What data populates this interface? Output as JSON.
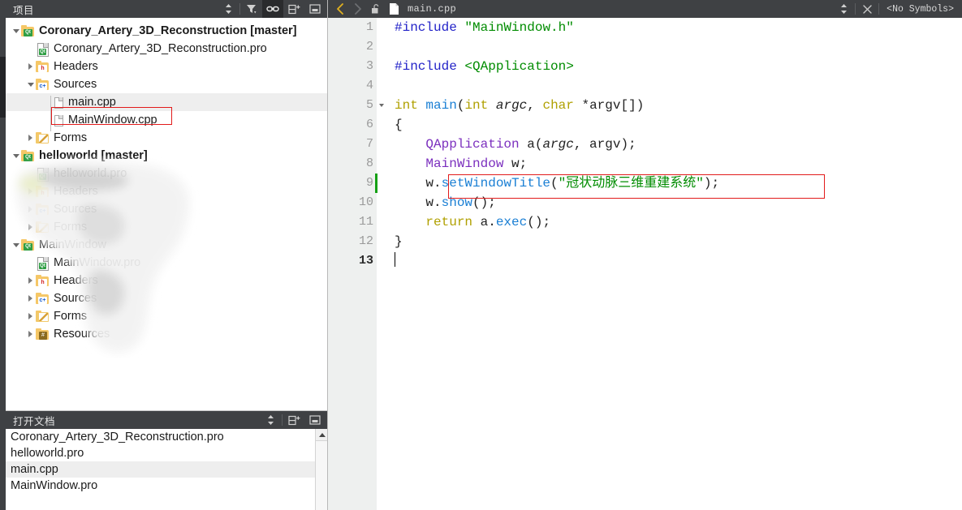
{
  "sidebar": {
    "header": {
      "title": "项目",
      "tools": [
        {
          "name": "sync-with-editor-icon",
          "glyph": "updown"
        },
        {
          "name": "filter-tree-icon",
          "glyph": "filter"
        },
        {
          "name": "link-with-editor-icon",
          "glyph": "link",
          "active": true
        },
        {
          "name": "split-add-icon",
          "glyph": "splitadd"
        },
        {
          "name": "close-panel-icon",
          "glyph": "closepanel"
        }
      ]
    },
    "tree": [
      {
        "label": "Coronary_Artery_3D_Reconstruction [master]",
        "indent": 0,
        "arrow": "down",
        "icon": "folder-qt",
        "bold": true,
        "blurred": false
      },
      {
        "label": "Coronary_Artery_3D_Reconstruction.pro",
        "indent": 1,
        "arrow": "none",
        "icon": "file-qt",
        "bold": false,
        "blurred": false
      },
      {
        "label": "Headers",
        "indent": 1,
        "arrow": "right",
        "icon": "folder-h",
        "bold": false,
        "blurred": false
      },
      {
        "label": "Sources",
        "indent": 1,
        "arrow": "down",
        "icon": "folder-c",
        "bold": false,
        "blurred": false
      },
      {
        "label": "main.cpp",
        "indent": 2,
        "arrow": "none",
        "icon": "cpp",
        "bold": false,
        "selected": true,
        "blurred": false
      },
      {
        "label": "MainWindow.cpp",
        "indent": 2,
        "arrow": "none",
        "icon": "cpp",
        "bold": false,
        "blurred": false
      },
      {
        "label": "Forms",
        "indent": 1,
        "arrow": "right",
        "icon": "folder-form",
        "bold": false,
        "blurred": false
      },
      {
        "label": "helloworld [master]",
        "indent": 0,
        "arrow": "down",
        "icon": "folder-qt",
        "bold": true,
        "blurred": true
      },
      {
        "label": "helloworld.pro",
        "indent": 1,
        "arrow": "none",
        "icon": "file-qt",
        "bold": false,
        "blurred": true
      },
      {
        "label": "Headers",
        "indent": 1,
        "arrow": "right",
        "icon": "folder-h",
        "bold": false,
        "blurred": true
      },
      {
        "label": "Sources",
        "indent": 1,
        "arrow": "right",
        "icon": "folder-c",
        "bold": false,
        "blurred": true
      },
      {
        "label": "Forms",
        "indent": 1,
        "arrow": "right",
        "icon": "folder-form",
        "bold": false,
        "blurred": true
      },
      {
        "label": "MainWindow",
        "indent": 0,
        "arrow": "down",
        "icon": "folder-qt",
        "bold": false,
        "blurred": true
      },
      {
        "label": "MainWindow.pro",
        "indent": 1,
        "arrow": "none",
        "icon": "file-qt",
        "bold": false,
        "blurred": true
      },
      {
        "label": "Headers",
        "indent": 1,
        "arrow": "right",
        "icon": "folder-h",
        "bold": false,
        "blurred": true
      },
      {
        "label": "Sources",
        "indent": 1,
        "arrow": "right",
        "icon": "folder-c",
        "bold": false,
        "blurred": true
      },
      {
        "label": "Forms",
        "indent": 1,
        "arrow": "right",
        "icon": "folder-form",
        "bold": false,
        "blurred": true
      },
      {
        "label": "Resources",
        "indent": 1,
        "arrow": "right",
        "icon": "folder-res",
        "bold": false,
        "blurred": true
      }
    ]
  },
  "opendocs": {
    "header": {
      "title": "打开文档",
      "tools": [
        {
          "name": "sort-documents-icon",
          "glyph": "updown"
        },
        {
          "name": "split-add-icon",
          "glyph": "splitadd"
        },
        {
          "name": "close-panel-icon",
          "glyph": "closepanel"
        }
      ]
    },
    "items": [
      {
        "label": "Coronary_Artery_3D_Reconstruction.pro",
        "selected": false
      },
      {
        "label": "helloworld.pro",
        "selected": false
      },
      {
        "label": "main.cpp",
        "selected": true
      },
      {
        "label": "MainWindow.pro",
        "selected": false
      }
    ]
  },
  "editor": {
    "toolbar": {
      "back_icon": "back-arrow-icon",
      "forward_icon": "forward-arrow-icon",
      "lock_icon": "unlocked-icon",
      "file_icon": "file-icon",
      "filename": "main.cpp",
      "sort_icon": "sort-icon",
      "close_icon": "close-icon",
      "symbols": "<No Symbols>"
    },
    "lines": [
      {
        "n": "1",
        "fold": false,
        "changed": false,
        "current": false
      },
      {
        "n": "2",
        "fold": false,
        "changed": false,
        "current": false
      },
      {
        "n": "3",
        "fold": false,
        "changed": false,
        "current": false
      },
      {
        "n": "4",
        "fold": false,
        "changed": false,
        "current": false
      },
      {
        "n": "5",
        "fold": true,
        "changed": false,
        "current": false
      },
      {
        "n": "6",
        "fold": false,
        "changed": false,
        "current": false
      },
      {
        "n": "7",
        "fold": false,
        "changed": false,
        "current": false
      },
      {
        "n": "8",
        "fold": false,
        "changed": false,
        "current": false
      },
      {
        "n": "9",
        "fold": false,
        "changed": true,
        "current": false
      },
      {
        "n": "10",
        "fold": false,
        "changed": false,
        "current": false
      },
      {
        "n": "11",
        "fold": false,
        "changed": false,
        "current": false
      },
      {
        "n": "12",
        "fold": false,
        "changed": false,
        "current": false
      },
      {
        "n": "13",
        "fold": false,
        "changed": false,
        "current": true
      }
    ],
    "code": {
      "l1_inc": "#include",
      "l1_hdr": "\"MainWindow.h\"",
      "l3_inc": "#include",
      "l3_hdr": "<QApplication>",
      "l5_int": "int",
      "l5_main": "main",
      "l5_p1": "(",
      "l5_int2": "int",
      "l5_argc": "argc",
      "l5_c": ", ",
      "l5_char": "char",
      "l5_argv": " *argv[])",
      "l6": "{",
      "l7_cls": "QApplication",
      "l7_a": " a(",
      "l7_argc": "argc",
      "l7_rest": ", argv);",
      "l8_cls": "MainWindow",
      "l8_rest": " w;",
      "l9_w": "w.",
      "l9_fn": "setWindowTitle",
      "l9_open": "(",
      "l9_str": "\"冠状动脉三维重建系统\"",
      "l9_close": ");",
      "l10_w": "w.",
      "l10_fn": "show",
      "l10_rest": "();",
      "l11_ret": "return",
      "l11_a": " a.",
      "l11_fn": "exec",
      "l11_rest": "();",
      "l12": "}"
    },
    "annotation_color": "#e21b1b"
  },
  "colors": {
    "chrome_dark": "#3f4144",
    "panel_bg": "#ffffff",
    "selection": "#eeeeee",
    "gutter_bg": "#eef0ef",
    "change_marker": "#14a014",
    "annotation_red": "#e21b1b",
    "string_green": "#008c00",
    "keyword_purple": "#7b2fbe",
    "preproc_blue": "#2222c8"
  }
}
